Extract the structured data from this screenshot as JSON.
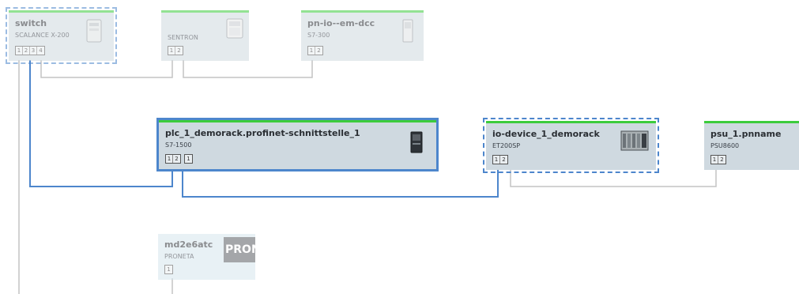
{
  "devices": [
    {
      "id": "switch",
      "name": "switch",
      "type": "SCALANCE X-200",
      "ports": [
        [
          "1",
          "2",
          "3",
          "4"
        ]
      ],
      "icon": "switch-device-icon"
    },
    {
      "id": "sentron",
      "name": "",
      "type": "SENTRON",
      "ports": [
        [
          "1",
          "2"
        ]
      ],
      "icon": "sentron-device-icon"
    },
    {
      "id": "pnio",
      "name": "pn-io--em-dcc",
      "type": "S7-300",
      "ports": [
        [
          "1",
          "2"
        ]
      ],
      "icon": "s7-300-device-icon"
    },
    {
      "id": "plc",
      "name": "plc_1_demorack.profinet-schnittstelle_1",
      "type": "S7-1500",
      "ports": [
        [
          "1",
          "2"
        ],
        [
          "1"
        ]
      ],
      "icon": "s7-1500-device-icon"
    },
    {
      "id": "iodevice",
      "name": "io-device_1_demorack",
      "type": "ET200SP",
      "ports": [
        [
          "1",
          "2"
        ]
      ],
      "icon": "et200sp-device-icon"
    },
    {
      "id": "psu",
      "name": "psu_1.pnname",
      "type": "PSU8600",
      "ports": [
        [
          "1",
          "2"
        ]
      ],
      "icon": ""
    },
    {
      "id": "proneta",
      "name": "md2e6atc",
      "type": "PRONETA",
      "ports": [
        [
          "1"
        ]
      ],
      "icon": "proneta-logo-icon",
      "logo_text": "PRON"
    }
  ],
  "colors": {
    "status_ok": "#3ccc3c",
    "link_selected": "#4d86cc",
    "link_default": "#c4c4c4",
    "node_bg": "#cfd9e0"
  }
}
